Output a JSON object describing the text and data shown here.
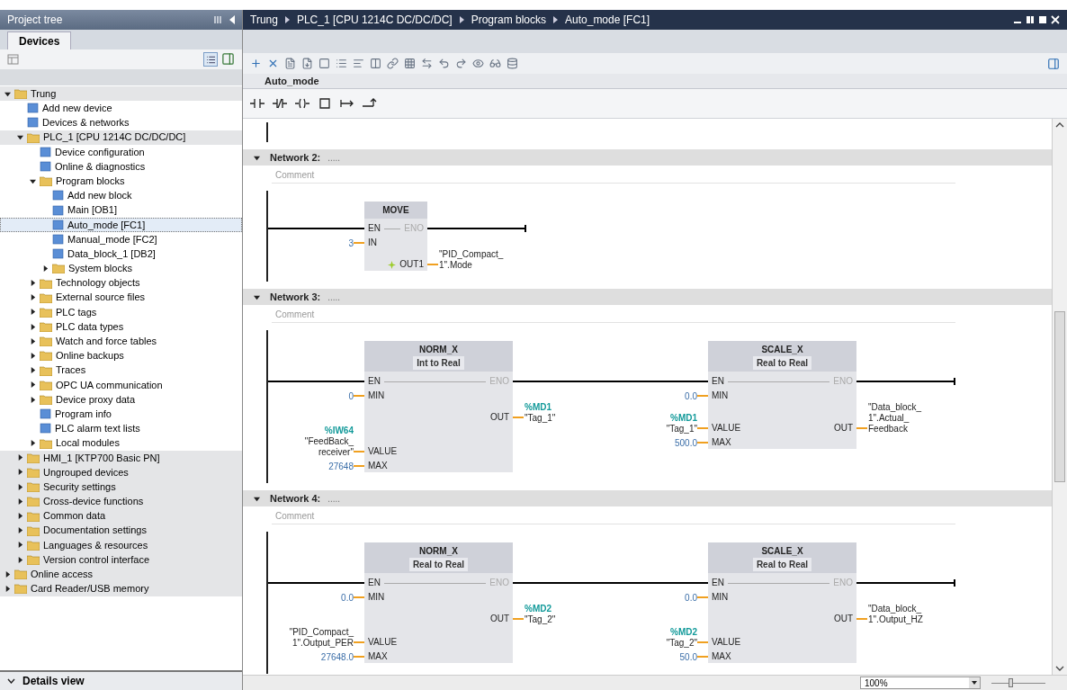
{
  "project_tree": {
    "title": "Project tree",
    "tabs": [
      {
        "label": "Devices",
        "selected": true
      }
    ],
    "tree": [
      {
        "label": "Trung",
        "expanded": true,
        "selected": false,
        "children": [
          {
            "label": "Add new device",
            "selected": false
          },
          {
            "label": "Devices & networks",
            "selected": false
          },
          {
            "label": "PLC_1 [CPU 1214C DC/DC/DC]",
            "expanded": true,
            "selected": false,
            "children": [
              {
                "label": "Device configuration",
                "selected": false
              },
              {
                "label": "Online & diagnostics",
                "selected": false
              },
              {
                "label": "Program blocks",
                "expanded": true,
                "selected": false,
                "children": [
                  {
                    "label": "Add new block",
                    "selected": false
                  },
                  {
                    "label": "Main [OB1]",
                    "selected": false
                  },
                  {
                    "label": "Auto_mode [FC1]",
                    "selected": true
                  },
                  {
                    "label": "Manual_mode [FC2]",
                    "selected": false
                  },
                  {
                    "label": "Data_block_1 [DB2]",
                    "selected": false
                  },
                  {
                    "label": "System blocks",
                    "expanded": false,
                    "selected": false
                  }
                ]
              },
              {
                "label": "Technology objects",
                "expanded": false,
                "selected": false
              },
              {
                "label": "External source files",
                "expanded": false,
                "selected": false
              },
              {
                "label": "PLC tags",
                "expanded": false,
                "selected": false
              },
              {
                "label": "PLC data types",
                "expanded": false,
                "selected": false
              },
              {
                "label": "Watch and force tables",
                "expanded": false,
                "selected": false
              },
              {
                "label": "Online backups",
                "expanded": false,
                "selected": false
              },
              {
                "label": "Traces",
                "expanded": false,
                "selected": false
              },
              {
                "label": "OPC UA communication",
                "expanded": false,
                "selected": false
              },
              {
                "label": "Device proxy data",
                "expanded": false,
                "selected": false
              },
              {
                "label": "Program info",
                "selected": false
              },
              {
                "label": "PLC alarm text lists",
                "selected": false
              },
              {
                "label": "Local modules",
                "expanded": false,
                "selected": false
              }
            ]
          },
          {
            "label": "HMI_1 [KTP700 Basic PN]",
            "expanded": false,
            "selected": false
          },
          {
            "label": "Ungrouped devices",
            "expanded": false,
            "selected": false
          },
          {
            "label": "Security settings",
            "expanded": false,
            "selected": false
          },
          {
            "label": "Cross-device functions",
            "expanded": false,
            "selected": false
          },
          {
            "label": "Common data",
            "expanded": false,
            "selected": false
          },
          {
            "label": "Documentation settings",
            "expanded": false,
            "selected": false
          },
          {
            "label": "Languages & resources",
            "expanded": false,
            "selected": false
          },
          {
            "label": "Version control interface",
            "expanded": false,
            "selected": false
          }
        ]
      },
      {
        "label": "Online access",
        "expanded": false,
        "selected": false
      },
      {
        "label": "Card Reader/USB memory",
        "expanded": false,
        "selected": false
      }
    ],
    "details_view": {
      "label": "Details view",
      "expanded": false
    }
  },
  "editor": {
    "breadcrumb": [
      "Trung",
      "PLC_1 [CPU 1214C DC/DC/DC]",
      "Program blocks",
      "Auto_mode [FC1]"
    ],
    "block_name": "Auto_mode",
    "networks": [
      {
        "title": "Network 2:",
        "title_hint": ".....",
        "expanded": true,
        "comment": {
          "placeholder": "Comment"
        },
        "blocks": [
          {
            "name": "MOVE",
            "rows": [
              {
                "kind": "enable",
                "in": "EN",
                "out": "ENO"
              },
              {
                "kind": "data",
                "in": {
                  "pin": "IN",
                  "operand": {
                    "kind": "constant",
                    "lines": [
                      "3"
                    ]
                  }
                }
              },
              {
                "kind": "data",
                "out": {
                  "pin": "OUT1",
                  "marker": true,
                  "operand": {
                    "kind": "tag",
                    "lines": [
                      "\"PID_Compact_",
                      "1\".Mode"
                    ]
                  }
                }
              }
            ]
          }
        ]
      },
      {
        "title": "Network 3:",
        "title_hint": ".....",
        "expanded": true,
        "comment": {
          "placeholder": "Comment"
        },
        "blocks": [
          {
            "name": "NORM_X",
            "subtitle": "Int to Real",
            "rows": [
              {
                "kind": "enable",
                "in": "EN",
                "out": "ENO"
              },
              {
                "kind": "data",
                "in": {
                  "pin": "MIN",
                  "operand": {
                    "kind": "constant",
                    "lines": [
                      "0"
                    ]
                  }
                }
              },
              {
                "kind": "data",
                "out": {
                  "pin": "OUT",
                  "marker": false,
                  "operand": {
                    "kind": "tag",
                    "address": "%MD1",
                    "lines": [
                      "\"Tag_1\""
                    ]
                  }
                }
              },
              {
                "kind": "data",
                "in": {
                  "pin": "VALUE",
                  "operand": {
                    "kind": "tag",
                    "address": "%IW64",
                    "lines": [
                      "\"FeedBack_",
                      "receiver\""
                    ]
                  }
                }
              },
              {
                "kind": "data",
                "in": {
                  "pin": "MAX",
                  "operand": {
                    "kind": "constant",
                    "lines": [
                      "27648"
                    ]
                  }
                }
              }
            ]
          },
          {
            "name": "SCALE_X",
            "subtitle": "Real to Real",
            "rows": [
              {
                "kind": "enable",
                "in": "EN",
                "out": "ENO"
              },
              {
                "kind": "data",
                "in": {
                  "pin": "MIN",
                  "operand": {
                    "kind": "constant",
                    "lines": [
                      "0.0"
                    ]
                  }
                }
              },
              {
                "kind": "data",
                "in": {
                  "pin": "VALUE",
                  "operand": {
                    "kind": "tag",
                    "address": "%MD1",
                    "lines": [
                      "\"Tag_1\""
                    ]
                  }
                },
                "out": {
                  "pin": "OUT",
                  "marker": false,
                  "operand": {
                    "kind": "tag",
                    "lines": [
                      "\"Data_block_",
                      "1\".Actual_",
                      "Feedback"
                    ]
                  }
                }
              },
              {
                "kind": "data",
                "in": {
                  "pin": "MAX",
                  "operand": {
                    "kind": "constant",
                    "lines": [
                      "500.0"
                    ]
                  }
                }
              }
            ]
          }
        ]
      },
      {
        "title": "Network 4:",
        "title_hint": ".....",
        "expanded": true,
        "comment": {
          "placeholder": "Comment"
        },
        "blocks": [
          {
            "name": "NORM_X",
            "subtitle": "Real to Real",
            "rows": [
              {
                "kind": "enable",
                "in": "EN",
                "out": "ENO"
              },
              {
                "kind": "data",
                "in": {
                  "pin": "MIN",
                  "operand": {
                    "kind": "constant",
                    "lines": [
                      "0.0"
                    ]
                  }
                }
              },
              {
                "kind": "data",
                "out": {
                  "pin": "OUT",
                  "marker": false,
                  "operand": {
                    "kind": "tag",
                    "address": "%MD2",
                    "lines": [
                      "\"Tag_2\""
                    ]
                  }
                }
              },
              {
                "kind": "data",
                "in": {
                  "pin": "VALUE",
                  "operand": {
                    "kind": "tag",
                    "lines": [
                      "\"PID_Compact_",
                      "1\".Output_PER"
                    ]
                  }
                }
              },
              {
                "kind": "data",
                "in": {
                  "pin": "MAX",
                  "operand": {
                    "kind": "constant",
                    "lines": [
                      "27648.0"
                    ]
                  }
                }
              }
            ]
          },
          {
            "name": "SCALE_X",
            "subtitle": "Real to Real",
            "rows": [
              {
                "kind": "enable",
                "in": "EN",
                "out": "ENO"
              },
              {
                "kind": "data",
                "in": {
                  "pin": "MIN",
                  "operand": {
                    "kind": "constant",
                    "lines": [
                      "0.0"
                    ]
                  }
                }
              },
              {
                "kind": "data",
                "out": {
                  "pin": "OUT",
                  "marker": false,
                  "operand": {
                    "kind": "tag",
                    "lines": [
                      "\"Data_block_",
                      "1\".Output_HZ"
                    ]
                  }
                }
              },
              {
                "kind": "data",
                "in": {
                  "pin": "VALUE",
                  "operand": {
                    "kind": "tag",
                    "address": "%MD2",
                    "lines": [
                      "\"Tag_2\""
                    ]
                  }
                }
              },
              {
                "kind": "data",
                "in": {
                  "pin": "MAX",
                  "operand": {
                    "kind": "constant",
                    "lines": [
                      "50.0"
                    ]
                  }
                }
              }
            ]
          }
        ]
      }
    ],
    "zoom": {
      "value": "100%",
      "level": 0.35
    }
  }
}
